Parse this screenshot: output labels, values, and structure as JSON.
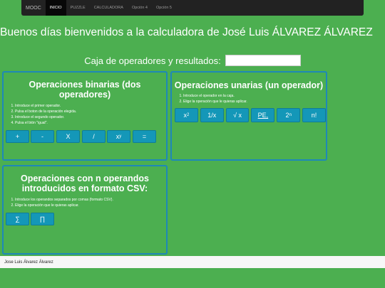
{
  "navbar": {
    "brand": "MOOC",
    "items": [
      {
        "label": "INICIO",
        "active": true
      },
      {
        "label": "PUZZLE",
        "active": false
      },
      {
        "label": "CALCULADORA",
        "active": false
      },
      {
        "label": "Opción 4",
        "active": false
      },
      {
        "label": "Opción 5",
        "active": false
      }
    ]
  },
  "greeting": "Buenos días bienvenidos a la calculadora de José Luis ÁLVAREZ ÁLVAREZ",
  "result": {
    "label": "Caja de operadores y resultados:",
    "value": ""
  },
  "binary": {
    "title": "Operaciones binarias (dos operadores)",
    "instructions": [
      "Introduce el primer operador.",
      "Pulsa el boton de la operación elegida.",
      "Introduce el segundo operador.",
      "Pulsa el btón \"igual\"."
    ],
    "buttons": [
      "+",
      "-",
      "X",
      "/",
      "x",
      "="
    ],
    "power_sup": "y"
  },
  "unary": {
    "title": "Operaciones unarias (un operador)",
    "instructions": [
      "Introduce el operador en la caja.",
      "Elige la operación que le quieras aplicar."
    ],
    "buttons": [
      "x",
      "1/x",
      "√ x",
      "PE,",
      "2",
      "n!"
    ],
    "square_sup": "2",
    "pow2_sup": "n"
  },
  "csv": {
    "title": "Operaciones con n operandos introducidos en formato CSV:",
    "instructions": [
      "Introduce los operandos separados por comas (formato CSV).",
      "Elige la operación que le quieras aplicar."
    ],
    "buttons": [
      "∑",
      "∏"
    ]
  },
  "footer": "Jose Luis Álvarez Álvarez",
  "colors": {
    "background": "#4caf50",
    "navbar": "#222222",
    "button": "#1497b8",
    "panel_border": "#1e88b8"
  }
}
